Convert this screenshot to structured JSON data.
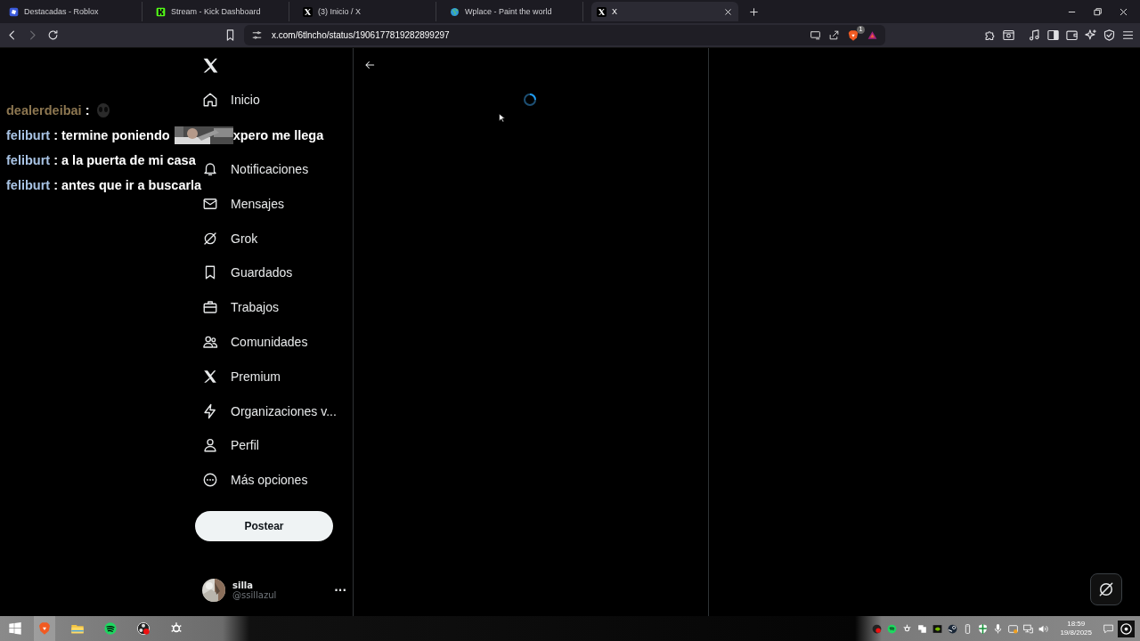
{
  "browser": {
    "tabs": [
      {
        "title": "Destacadas - Roblox",
        "selected": false
      },
      {
        "title": "Stream - Kick Dashboard",
        "selected": false
      },
      {
        "title": "(3) Inicio / X",
        "selected": false
      },
      {
        "title": "Wplace - Paint the world",
        "selected": false
      },
      {
        "title": "X",
        "selected": true
      }
    ],
    "url": "x.com/6tlncho/status/1906177819282899297",
    "shields_badge": "1"
  },
  "chat_overlay": [
    {
      "user": "dealerdeibai",
      "color": "#8c7650",
      "parts": [
        {
          "kind": "text",
          "text": " :"
        },
        {
          "kind": "emote"
        }
      ]
    },
    {
      "user": "feliburt",
      "color": "#a8c3e4",
      "parts": [
        {
          "kind": "text",
          "text": " : termine poniendo"
        },
        {
          "kind": "picture"
        },
        {
          "kind": "text",
          "text": "xpero me llega"
        }
      ]
    },
    {
      "user": "feliburt",
      "color": "#a8c3e4",
      "parts": [
        {
          "kind": "text",
          "text": " : a la puerta de mi casa"
        }
      ]
    },
    {
      "user": "feliburt",
      "color": "#a8c3e4",
      "parts": [
        {
          "kind": "text",
          "text": " : antes que ir a buscarla"
        }
      ]
    }
  ],
  "sidebar": {
    "items": [
      {
        "label": "Inicio"
      },
      {
        "label": "Notificaciones"
      },
      {
        "label": "Mensajes"
      },
      {
        "label": "Grok"
      },
      {
        "label": "Guardados"
      },
      {
        "label": "Trabajos"
      },
      {
        "label": "Comunidades"
      },
      {
        "label": "Premium"
      },
      {
        "label": "Organizaciones v..."
      },
      {
        "label": "Perfil"
      },
      {
        "label": "Más opciones"
      }
    ],
    "post_button": "Postear",
    "account": {
      "name": "silla",
      "handle": "@ssillazul",
      "menu": "···"
    }
  },
  "taskbar": {
    "time": "18:59",
    "date": "19/8/2025"
  }
}
